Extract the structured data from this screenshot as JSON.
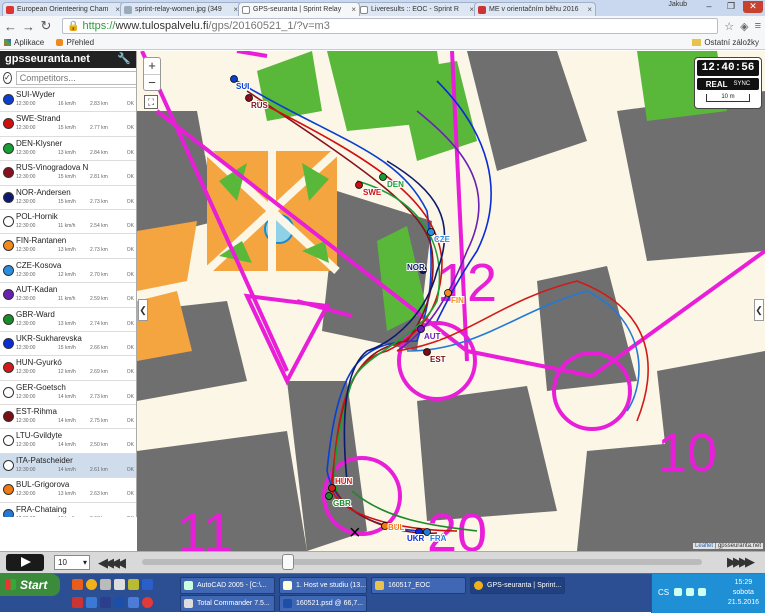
{
  "browser": {
    "tabs": [
      {
        "label": "European Orienteering Cham"
      },
      {
        "label": "sprint-relay-women.jpg (349"
      },
      {
        "label": "GPS-seuranta | Sprint Relay"
      },
      {
        "label": "Liveresults :: EOC - Sprint R"
      },
      {
        "label": "ME v orientačním běhu 2016"
      }
    ],
    "user": "Jakub",
    "url_scheme": "https://",
    "url_host": "www.tulospalvelu.fi",
    "url_path": "/gps/20160521_1/?v=m3",
    "bookmarks": [
      {
        "label": "Aplikace"
      },
      {
        "label": "Přehled"
      }
    ],
    "other_bookmarks": "Ostatní záložky"
  },
  "sidebar": {
    "brand": "gpsseuranta.net",
    "search_placeholder": "Competitors...",
    "runners": [
      {
        "name": "SUI-Wyder",
        "time": "12:30:00",
        "speed": "16 km/h",
        "dist": "2.83 km",
        "status": "OK",
        "color": "#0a3fd1"
      },
      {
        "name": "SWE-Strand",
        "time": "12:30:00",
        "speed": "15 km/h",
        "dist": "2.77 km",
        "status": "OK",
        "color": "#d10f0f"
      },
      {
        "name": "DEN-Klysner",
        "time": "12:30:00",
        "speed": "13 km/h",
        "dist": "2.84 km",
        "status": "OK",
        "color": "#16a034"
      },
      {
        "name": "RUS-Vinogradova N",
        "time": "12:30:00",
        "speed": "15 km/h",
        "dist": "2.81 km",
        "status": "OK",
        "color": "#8a0f1c"
      },
      {
        "name": "NOR-Andersen",
        "time": "12:30:00",
        "speed": "15 km/h",
        "dist": "2.73 km",
        "status": "OK",
        "color": "#0b1a6e"
      },
      {
        "name": "POL-Hornik",
        "time": "12:30:00",
        "speed": "11 km/h",
        "dist": "2.54 km",
        "status": "OK",
        "color": "#ffffff"
      },
      {
        "name": "FIN-Rantanen",
        "time": "12:30:00",
        "speed": "13 km/h",
        "dist": "2.73 km",
        "status": "OK",
        "color": "#f28a1c"
      },
      {
        "name": "CZE-Kosova",
        "time": "12:30:00",
        "speed": "12 km/h",
        "dist": "2.70 km",
        "status": "OK",
        "color": "#2a8fe0"
      },
      {
        "name": "AUT-Kadan",
        "time": "12:30:00",
        "speed": "11 km/h",
        "dist": "2.59 km",
        "status": "OK",
        "color": "#6a1fb5"
      },
      {
        "name": "GBR-Ward",
        "time": "12:30:00",
        "speed": "13 km/h",
        "dist": "2.74 km",
        "status": "OK",
        "color": "#1d8a2a"
      },
      {
        "name": "UKR-Sukharevska",
        "time": "12:30:00",
        "speed": "15 km/h",
        "dist": "2.66 km",
        "status": "OK",
        "color": "#0a2bd8"
      },
      {
        "name": "HUN-Gyurkó",
        "time": "12:30:00",
        "speed": "12 km/h",
        "dist": "2.69 km",
        "status": "OK",
        "color": "#d11a1a"
      },
      {
        "name": "GER-Goetsch",
        "time": "12:30:00",
        "speed": "14 km/h",
        "dist": "2.73 km",
        "status": "OK",
        "color": "#ffffff"
      },
      {
        "name": "EST-Rihma",
        "time": "12:30:00",
        "speed": "14 km/h",
        "dist": "2.75 km",
        "status": "OK",
        "color": "#7a0e14"
      },
      {
        "name": "LTU-Gvildyte",
        "time": "12:30:00",
        "speed": "14 km/h",
        "dist": "2.50 km",
        "status": "OK",
        "color": "#ffffff"
      },
      {
        "name": "ITA-Patscheider",
        "time": "12:30:00",
        "speed": "14 km/h",
        "dist": "2.61 km",
        "status": "OK",
        "color": "#ffffff",
        "selected": true
      },
      {
        "name": "BUL-Grigorova",
        "time": "12:30:00",
        "speed": "13 km/h",
        "dist": "2.63 km",
        "status": "OK",
        "color": "#f07a12"
      },
      {
        "name": "FRA-Chataing",
        "time": "12:30:00",
        "speed": "13 km/h",
        "dist": "2.67 km",
        "status": "OK",
        "color": "#2279d6"
      }
    ]
  },
  "map": {
    "clock": "12:40:56",
    "real_label": "REAL",
    "sync_label": "SYNC",
    "scale_label": "10 m",
    "attribution_leaflet": "Leaflet",
    "attribution_site": "| gpsseuranta.net",
    "control_numbers": [
      "12",
      "10",
      "11",
      "20"
    ],
    "markers": [
      {
        "label": "SUI",
        "color": "#0a3fd1"
      },
      {
        "label": "RUS",
        "color": "#8a0f1c"
      },
      {
        "label": "DEN",
        "color": "#16a034"
      },
      {
        "label": "SWE",
        "color": "#d10f0f"
      },
      {
        "label": "CZE",
        "color": "#2a8fe0"
      },
      {
        "label": "NOR",
        "color": "#0b1a6e"
      },
      {
        "label": "FIN",
        "color": "#f28a1c"
      },
      {
        "label": "AUT",
        "color": "#6a1fb5"
      },
      {
        "label": "EST",
        "color": "#7a0e14"
      },
      {
        "label": "HUN",
        "color": "#d11a1a"
      },
      {
        "label": "GBR",
        "color": "#1d8a2a"
      },
      {
        "label": "BUL",
        "color": "#f07a12"
      },
      {
        "label": "UKR",
        "color": "#0a2bd8"
      },
      {
        "label": "FRA",
        "color": "#2279d6"
      }
    ]
  },
  "player": {
    "speed_value": "10",
    "progress": 0.26
  },
  "taskbar": {
    "start": "Start",
    "buttons": [
      {
        "label": "AutoCAD 2005 - [C:\\..."
      },
      {
        "label": "1. Host ve studiu (13..."
      },
      {
        "label": "160517_EOC"
      },
      {
        "label": "GPS-seuranta | Sprint..."
      },
      {
        "label": "Total Commander 7.5..."
      },
      {
        "label": "160521.psd @ 66,7..."
      }
    ],
    "lang": "CS",
    "time": "15:29",
    "day": "sobota",
    "date": "21.5.2016"
  }
}
